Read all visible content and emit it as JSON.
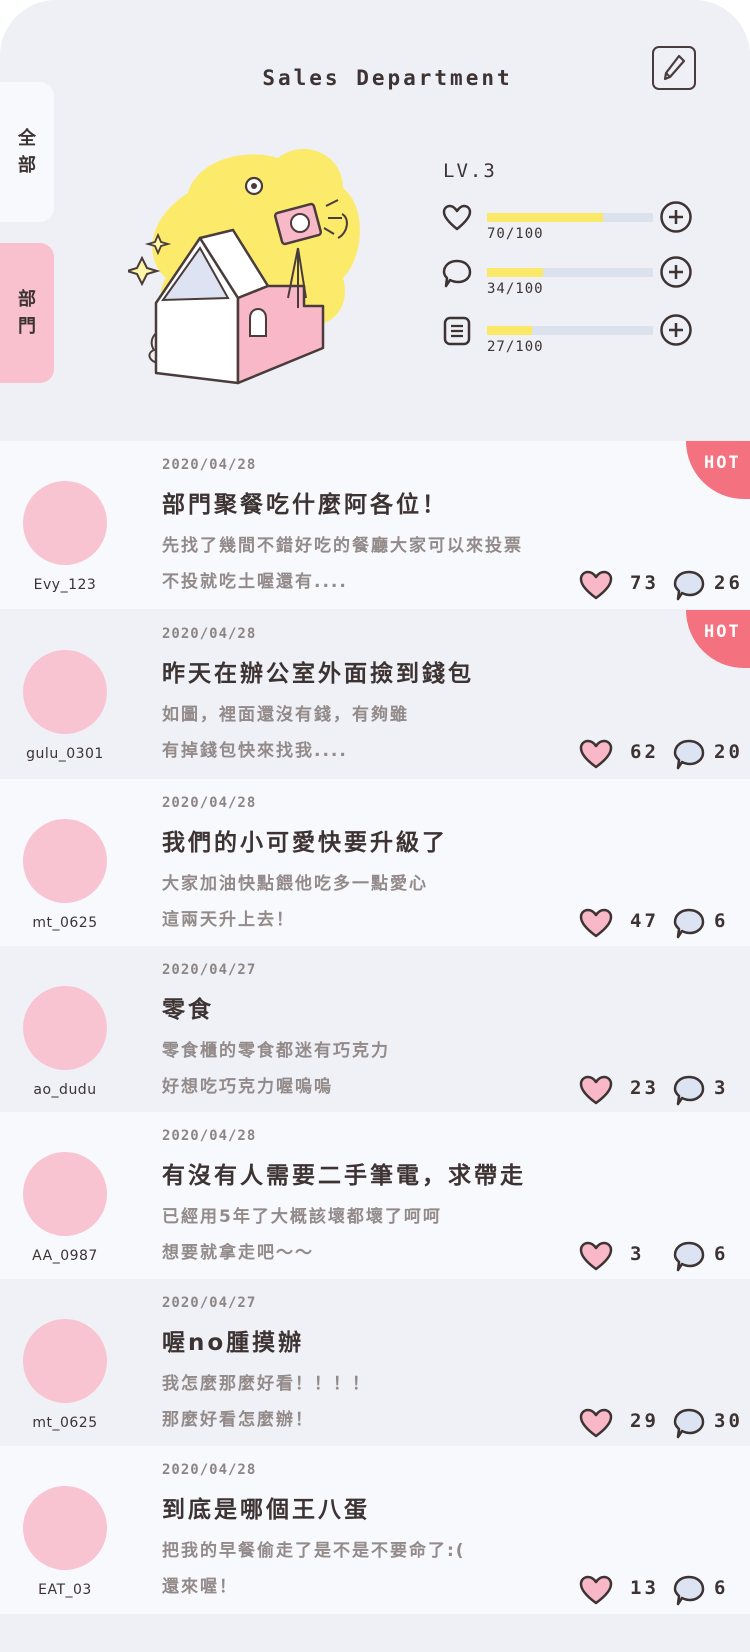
{
  "header": {
    "department_title": "Sales Department",
    "level": "LV.3",
    "tabs": [
      {
        "label": "全部",
        "chars": [
          "全",
          "部"
        ]
      },
      {
        "label": "部門",
        "chars": [
          "部",
          "門"
        ]
      }
    ],
    "stats": [
      {
        "icon": "heart-icon",
        "text": "70/100",
        "fraction": 0.7
      },
      {
        "icon": "comment-icon",
        "text": "34/100",
        "fraction": 0.34
      },
      {
        "icon": "document-icon",
        "text": "27/100",
        "fraction": 0.27
      }
    ]
  },
  "posts": [
    {
      "user": "Evy_123",
      "date": "2020/04/28",
      "title": "部門聚餐吃什麼阿各位！",
      "line1": "先找了幾間不錯好吃的餐廳大家可以來投票",
      "line2": "不投就吃土喔還有....",
      "likes": "73",
      "comments": "26",
      "hot": true,
      "hot_label": "HOT"
    },
    {
      "user": "gulu_0301",
      "date": "2020/04/28",
      "title": "昨天在辦公室外面撿到錢包",
      "line1": "如圖，裡面還沒有錢，有夠雖",
      "line2": "有掉錢包快來找我....",
      "likes": "62",
      "comments": "20",
      "hot": true,
      "hot_label": "HOT"
    },
    {
      "user": "mt_0625",
      "date": "2020/04/28",
      "title": "我們的小可愛快要升級了",
      "line1": "大家加油快點餵他吃多一點愛心",
      "line2": "這兩天升上去！",
      "likes": "47",
      "comments": "6",
      "hot": false
    },
    {
      "user": "ao_dudu",
      "date": "2020/04/27",
      "title": "零食",
      "line1": "零食櫃的零食都迷有巧克力",
      "line2": "好想吃巧克力喔嗚嗚",
      "likes": "23",
      "comments": "3",
      "hot": false
    },
    {
      "user": "AA_0987",
      "date": "2020/04/28",
      "title": "有沒有人需要二手筆電，求帶走",
      "line1": "已經用5年了大概該壞都壞了呵呵",
      "line2": "想要就拿走吧～～",
      "likes": "3",
      "comments": "6",
      "hot": false
    },
    {
      "user": "mt_0625",
      "date": "2020/04/27",
      "title": "喔no腫摸辦",
      "line1": "我怎麼那麼好看！！！！",
      "line2": "那麼好看怎麼辦！",
      "likes": "29",
      "comments": "30",
      "hot": false
    },
    {
      "user": "EAT_03",
      "date": "2020/04/28",
      "title": "到底是哪個王八蛋",
      "line1": "把我的早餐偷走了是不是不要命了:(",
      "line2": "還來喔！",
      "likes": "13",
      "comments": "6",
      "hot": false
    }
  ],
  "colors": {
    "accent_pink": "#f9c0cd",
    "hot_red": "#f4727f",
    "bar_yellow": "#fae868",
    "text_dark": "#3d3333"
  }
}
